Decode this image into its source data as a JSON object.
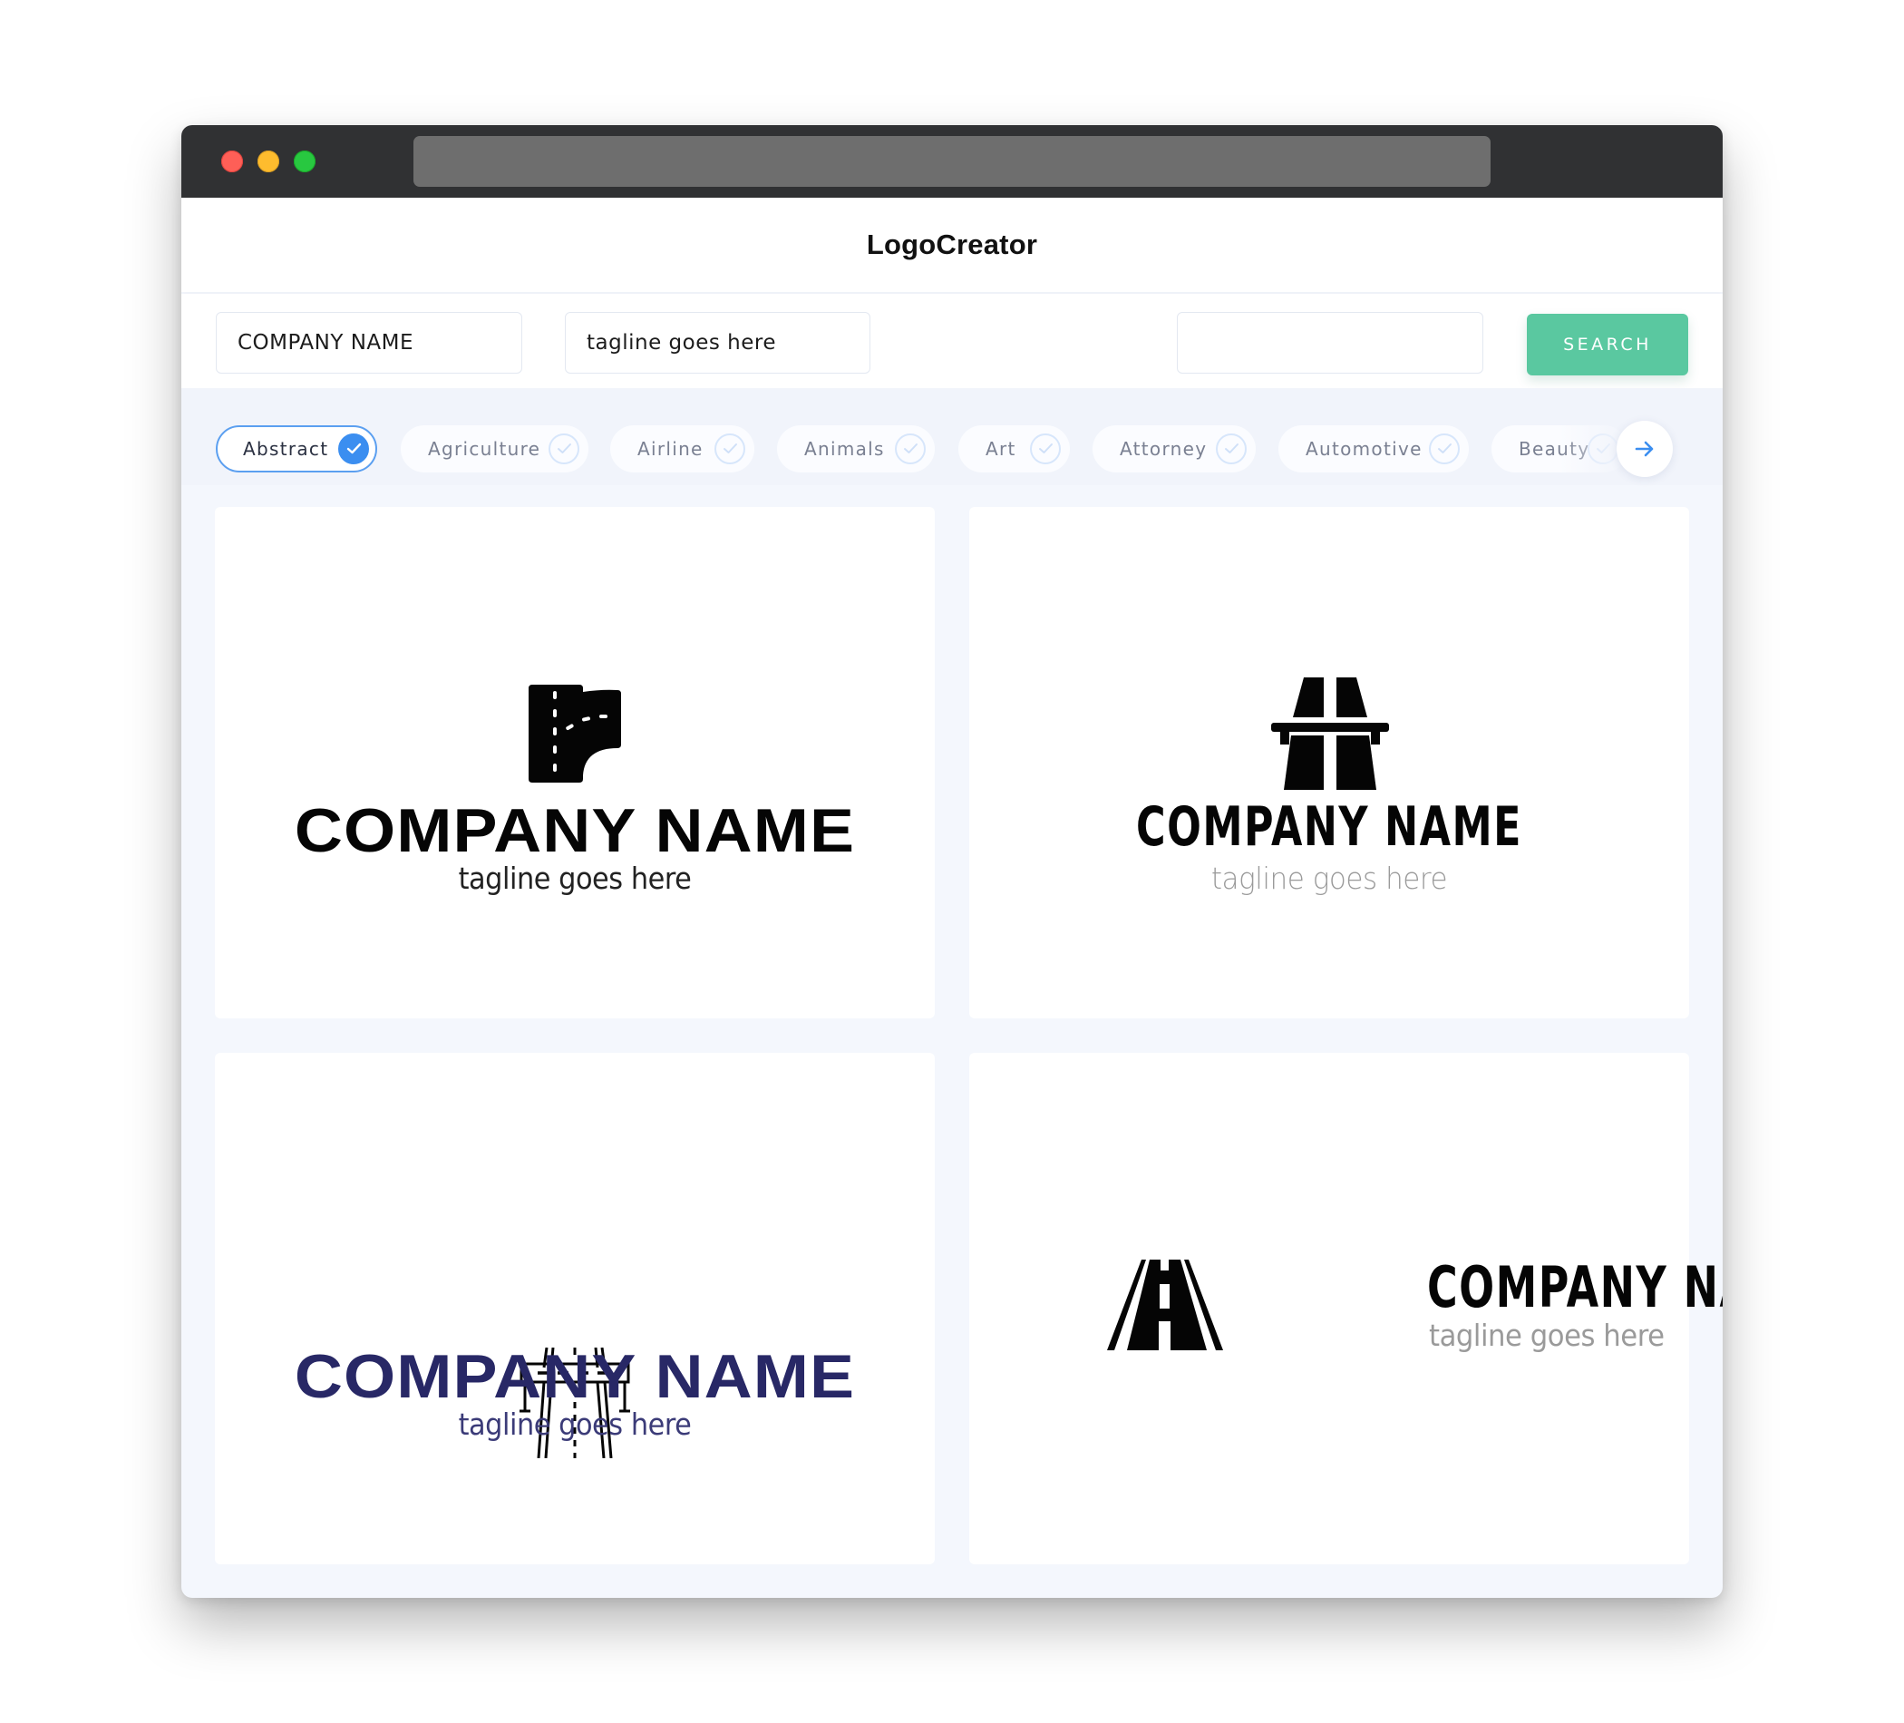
{
  "window": {
    "controls": [
      "close",
      "minimize",
      "maximize"
    ],
    "url": ""
  },
  "header": {
    "brand": "LogoCreator"
  },
  "search": {
    "company_name_value": "COMPANY NAME",
    "tagline_value": "tagline goes here",
    "keyword_value": "",
    "button_label": "SEARCH"
  },
  "categories": {
    "items": [
      {
        "label": "Abstract",
        "selected": true
      },
      {
        "label": "Agriculture",
        "selected": false
      },
      {
        "label": "Airline",
        "selected": false
      },
      {
        "label": "Animals",
        "selected": false
      },
      {
        "label": "Art",
        "selected": false
      },
      {
        "label": "Attorney",
        "selected": false
      },
      {
        "label": "Automotive",
        "selected": false
      },
      {
        "label": "Beauty",
        "selected": false
      }
    ],
    "next_icon": "arrow-right-icon"
  },
  "logos": [
    {
      "icon": "road-junction-icon",
      "name": "COMPANY NAME",
      "tagline": "tagline goes here",
      "name_color": "#050505",
      "tagline_color": "#222222"
    },
    {
      "icon": "motorway-icon",
      "name": "COMPANY NAME",
      "tagline": "tagline goes here",
      "name_color": "#050505",
      "tagline_color": "#9a9a9a"
    },
    {
      "icon": "highway-overpass-icon",
      "name": "COMPANY NAME",
      "tagline": "tagline goes here",
      "name_color": "#282866",
      "tagline_color": "#3b3b78"
    },
    {
      "icon": "road-perspective-icon",
      "name": "COMPANY NAME",
      "tagline": "tagline goes here",
      "name_color": "#050505",
      "tagline_color": "#9a9a9a"
    }
  ],
  "colors": {
    "accent_green": "#5ac8a0",
    "accent_blue": "#3b8ef0",
    "titlebar": "#303133",
    "background": "#f4f7fd"
  }
}
